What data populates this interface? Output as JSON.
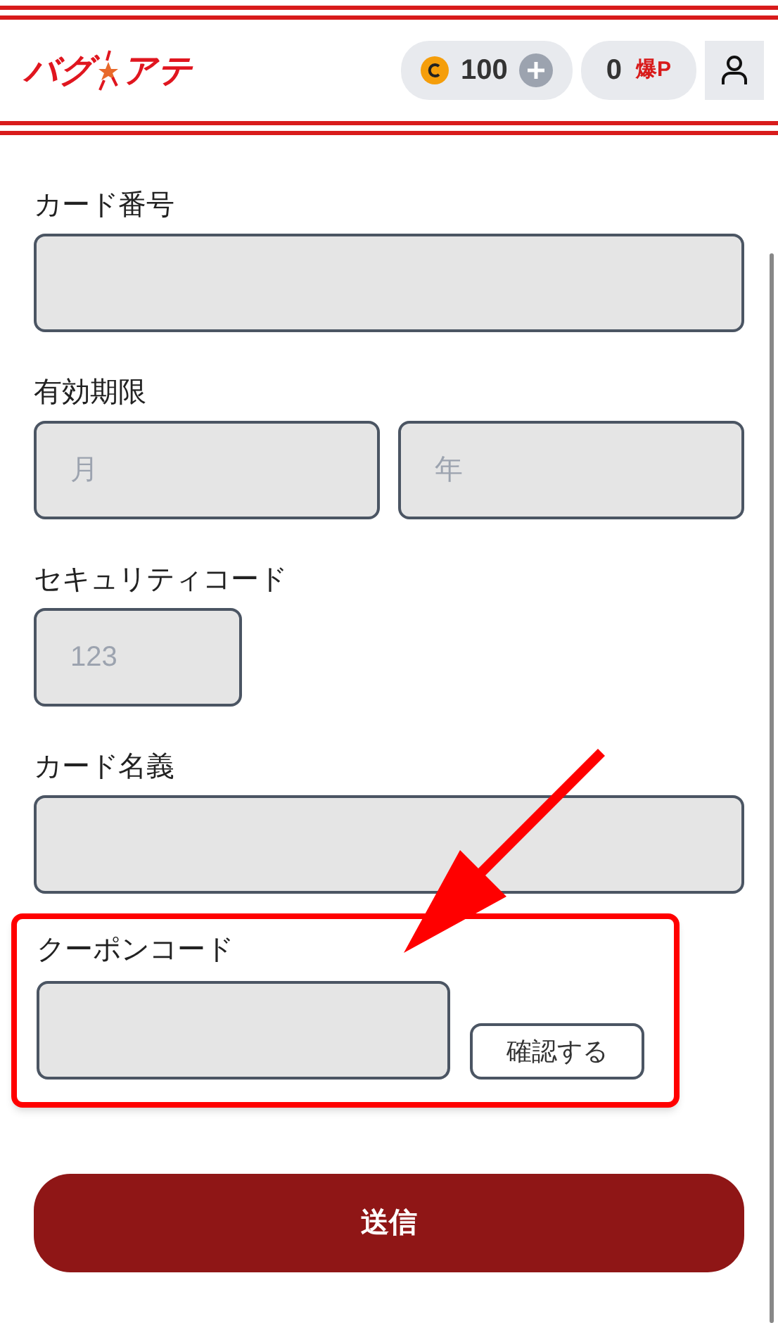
{
  "header": {
    "logo": {
      "left": "バグ",
      "right": "アテ"
    },
    "coins": {
      "value": "100"
    },
    "points": {
      "value": "0",
      "unit": "爆P"
    }
  },
  "form": {
    "fields": [
      {
        "kind": "text",
        "label": "カード番号"
      },
      {
        "kind": "pair",
        "label": "有効期限",
        "placeholders": [
          "月",
          "年"
        ]
      },
      {
        "kind": "short",
        "label": "セキュリティコード",
        "placeholder": "123"
      },
      {
        "kind": "text",
        "label": "カード名義"
      }
    ],
    "coupon": {
      "label": "クーポンコード",
      "button": "確認する",
      "highlighted": true
    },
    "submit": "送信"
  }
}
